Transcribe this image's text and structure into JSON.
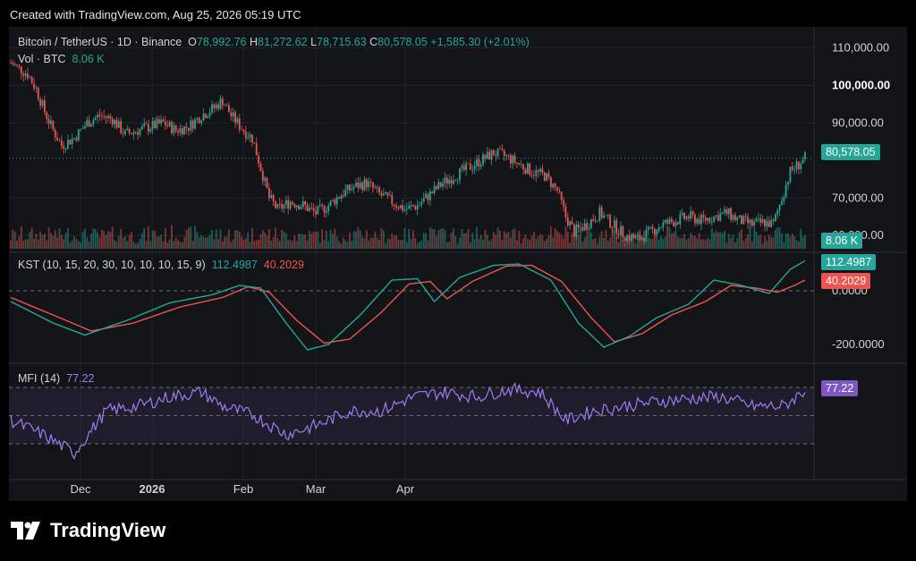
{
  "header": {
    "created": "Created with TradingView.com, Aug 25, 2026 05:19 UTC"
  },
  "legend": {
    "symbol": "Bitcoin / TetherUS · 1D · Binance",
    "o_label": "O",
    "o": "78,992.76",
    "h_label": "H",
    "h": "81,272.62",
    "l_label": "L",
    "l": "78,715.63",
    "c_label": "C",
    "c": "80,578.05",
    "change": "+1,585.30 (+2.01%)",
    "vol_label": "Vol · BTC",
    "vol": "8.06 K",
    "kst_label": "KST (10, 15, 20, 30, 10, 10, 10, 15, 9)",
    "kst": "112.4987",
    "kst_signal": "40.2029",
    "mfi_label": "MFI (14)",
    "mfi": "77.22"
  },
  "badges": {
    "price": "80,578.05",
    "vol": "8.06 K",
    "kst": "112.4987",
    "kst_signal": "40.2029",
    "mfi": "77.22"
  },
  "brand": {
    "name": "TradingView"
  },
  "colors": {
    "up": "#26a69a",
    "down": "#ef5350",
    "kst": "#26a69a",
    "signal": "#ef5350",
    "mfi": "#7e57c2",
    "background": "#131417"
  },
  "chart_data": [
    {
      "type": "candlestick",
      "title": "Bitcoin / TetherUS · 1D · Binance",
      "x_ticks": [
        "Dec",
        "2026",
        "Feb",
        "Mar",
        "Apr"
      ],
      "y_ticks": [
        "110,000.00",
        "100,000.00",
        "90,000.00",
        "70,000.00",
        "60,000.00"
      ],
      "ylim": [
        56000,
        112000
      ],
      "last_price": 80578.05,
      "close_path_approx": [
        [
          0,
          106000
        ],
        [
          8,
          103000
        ],
        [
          12,
          99000
        ],
        [
          16,
          93000
        ],
        [
          20,
          88000
        ],
        [
          24,
          84000
        ],
        [
          30,
          86000
        ],
        [
          36,
          90000
        ],
        [
          42,
          92000
        ],
        [
          48,
          91000
        ],
        [
          54,
          87000
        ],
        [
          60,
          88000
        ],
        [
          66,
          89000
        ],
        [
          72,
          90000
        ],
        [
          78,
          88000
        ],
        [
          84,
          89000
        ],
        [
          90,
          92000
        ],
        [
          96,
          94000
        ],
        [
          100,
          96000
        ],
        [
          104,
          92000
        ],
        [
          110,
          88000
        ],
        [
          114,
          86000
        ],
        [
          118,
          78000
        ],
        [
          122,
          70000
        ],
        [
          126,
          67000
        ],
        [
          132,
          69000
        ],
        [
          138,
          68000
        ],
        [
          144,
          66000
        ],
        [
          150,
          68000
        ],
        [
          156,
          71000
        ],
        [
          162,
          73000
        ],
        [
          168,
          74000
        ],
        [
          174,
          71000
        ],
        [
          180,
          69000
        ],
        [
          186,
          67000
        ],
        [
          192,
          68000
        ],
        [
          198,
          71000
        ],
        [
          204,
          74000
        ],
        [
          210,
          76000
        ],
        [
          216,
          78000
        ],
        [
          222,
          80000
        ],
        [
          228,
          82000
        ],
        [
          234,
          81000
        ],
        [
          240,
          79000
        ],
        [
          246,
          77000
        ],
        [
          252,
          76000
        ],
        [
          258,
          72000
        ],
        [
          262,
          65000
        ],
        [
          266,
          61000
        ],
        [
          272,
          63000
        ],
        [
          278,
          66000
        ],
        [
          284,
          63000
        ],
        [
          290,
          60000
        ],
        [
          296,
          59000
        ],
        [
          302,
          61000
        ],
        [
          308,
          63000
        ],
        [
          314,
          64000
        ],
        [
          320,
          65000
        ],
        [
          326,
          64000
        ],
        [
          332,
          65000
        ],
        [
          338,
          66000
        ],
        [
          344,
          64000
        ],
        [
          350,
          63000
        ],
        [
          356,
          63500
        ],
        [
          360,
          63000
        ],
        [
          364,
          70000
        ],
        [
          368,
          77000
        ],
        [
          372,
          79000
        ],
        [
          375,
          80578
        ]
      ]
    },
    {
      "type": "bar",
      "title": "Vol · BTC",
      "last_value": "8.06 K"
    },
    {
      "type": "line",
      "title": "KST (10, 15, 20, 30, 10, 10, 10, 15, 9)",
      "y_ticks": [
        "0.0000",
        "-200.0000"
      ],
      "series": [
        {
          "name": "KST",
          "last": 112.4987,
          "points": [
            [
              0,
              -40
            ],
            [
              20,
              -120
            ],
            [
              35,
              -165
            ],
            [
              55,
              -110
            ],
            [
              75,
              -45
            ],
            [
              95,
              -15
            ],
            [
              108,
              20
            ],
            [
              118,
              10
            ],
            [
              130,
              -120
            ],
            [
              140,
              -220
            ],
            [
              150,
              -200
            ],
            [
              165,
              -90
            ],
            [
              180,
              40
            ],
            [
              192,
              45
            ],
            [
              200,
              -40
            ],
            [
              212,
              50
            ],
            [
              228,
              95
            ],
            [
              240,
              100
            ],
            [
              255,
              40
            ],
            [
              268,
              -120
            ],
            [
              280,
              -210
            ],
            [
              292,
              -170
            ],
            [
              305,
              -100
            ],
            [
              320,
              -50
            ],
            [
              332,
              40
            ],
            [
              345,
              20
            ],
            [
              358,
              -10
            ],
            [
              368,
              80
            ],
            [
              375,
              112
            ]
          ]
        },
        {
          "name": "Signal",
          "last": 40.2029,
          "points": [
            [
              0,
              -25
            ],
            [
              20,
              -90
            ],
            [
              38,
              -150
            ],
            [
              58,
              -120
            ],
            [
              80,
              -60
            ],
            [
              100,
              -25
            ],
            [
              112,
              15
            ],
            [
              122,
              -5
            ],
            [
              135,
              -110
            ],
            [
              148,
              -195
            ],
            [
              160,
              -180
            ],
            [
              175,
              -80
            ],
            [
              188,
              25
            ],
            [
              198,
              35
            ],
            [
              206,
              -30
            ],
            [
              218,
              35
            ],
            [
              234,
              92
            ],
            [
              246,
              95
            ],
            [
              260,
              35
            ],
            [
              274,
              -100
            ],
            [
              285,
              -190
            ],
            [
              298,
              -160
            ],
            [
              312,
              -90
            ],
            [
              328,
              -40
            ],
            [
              340,
              20
            ],
            [
              352,
              10
            ],
            [
              362,
              -5
            ],
            [
              370,
              20
            ],
            [
              375,
              40
            ]
          ]
        }
      ]
    },
    {
      "type": "line",
      "title": "MFI (14)",
      "series": [
        {
          "name": "MFI",
          "last": 77.22,
          "points": [
            [
              0,
              45
            ],
            [
              15,
              30
            ],
            [
              30,
              10
            ],
            [
              45,
              55
            ],
            [
              60,
              60
            ],
            [
              75,
              70
            ],
            [
              90,
              75
            ],
            [
              100,
              60
            ],
            [
              115,
              50
            ],
            [
              130,
              30
            ],
            [
              145,
              40
            ],
            [
              160,
              55
            ],
            [
              175,
              55
            ],
            [
              190,
              70
            ],
            [
              205,
              75
            ],
            [
              220,
              70
            ],
            [
              235,
              78
            ],
            [
              250,
              75
            ],
            [
              262,
              45
            ],
            [
              275,
              55
            ],
            [
              290,
              60
            ],
            [
              305,
              65
            ],
            [
              320,
              68
            ],
            [
              335,
              70
            ],
            [
              350,
              60
            ],
            [
              365,
              60
            ],
            [
              375,
              77
            ]
          ]
        }
      ]
    }
  ]
}
